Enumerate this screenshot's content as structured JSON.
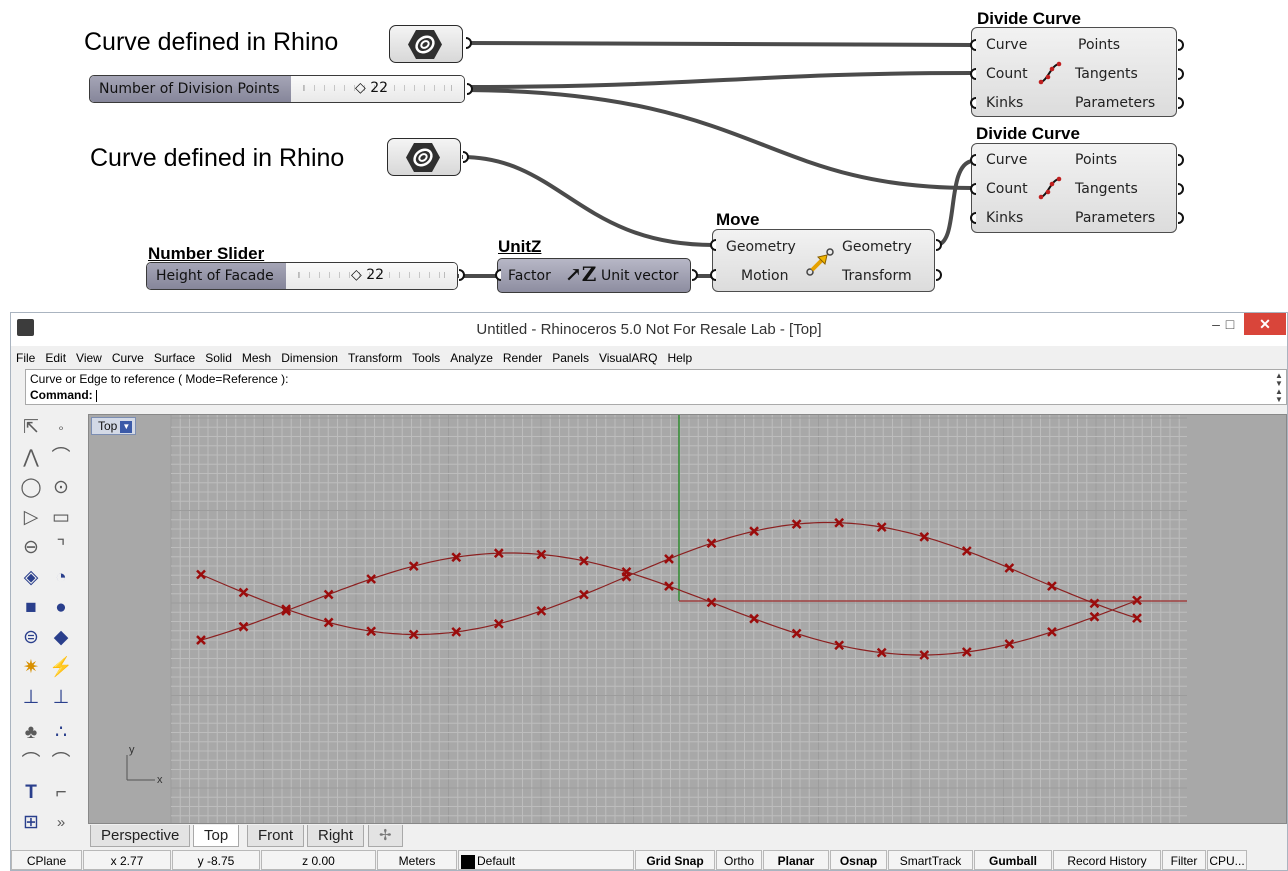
{
  "grasshopper": {
    "curve_label_1": "Curve defined in Rhino",
    "curve_label_2": "Curve defined in Rhino",
    "slider_1": {
      "name": "Number of Division Points",
      "value": "22"
    },
    "slider_2_title": "Number Slider",
    "slider_2": {
      "name": "Height of Facade",
      "value": "22"
    },
    "divide_1": {
      "title": "Divide Curve",
      "inputs": [
        "Curve",
        "Count",
        "Kinks"
      ],
      "outputs": [
        "Points",
        "Tangents",
        "Parameters"
      ]
    },
    "divide_2": {
      "title": "Divide Curve",
      "inputs": [
        "Curve",
        "Count",
        "Kinks"
      ],
      "outputs": [
        "Points",
        "Tangents",
        "Parameters"
      ]
    },
    "unitz": {
      "title": "UnitZ",
      "input": "Factor",
      "output": "Unit vector"
    },
    "move": {
      "title": "Move",
      "inputs": [
        "Geometry",
        "Motion"
      ],
      "outputs": [
        "Geometry",
        "Transform"
      ]
    },
    "colors": {
      "wire": "#4b4b4b",
      "component": "#e3e3e3",
      "dark_component": "#9b9bac"
    },
    "icons": {
      "curve_param": "curve-param-icon",
      "divide": "divide-curve-icon",
      "unitz": "unitz-icon",
      "move": "move-icon"
    }
  },
  "rhino": {
    "window_title": "Untitled - Rhinoceros 5.0 Not For Resale Lab - [Top]",
    "window_buttons": {
      "minimize": "–",
      "maximize": "□",
      "close": "✕"
    },
    "menu": [
      "File",
      "Edit",
      "View",
      "Curve",
      "Surface",
      "Solid",
      "Mesh",
      "Dimension",
      "Transform",
      "Tools",
      "Analyze",
      "Render",
      "Panels",
      "VisualARQ",
      "Help"
    ],
    "command_history": "Curve or Edge to reference ( Mode=Reference ):",
    "command_prompt": "Command:",
    "viewport_name": "Top",
    "axis_x": "x",
    "axis_y": "y",
    "view_tabs": [
      "Perspective",
      "Top",
      "Front",
      "Right"
    ],
    "add_tab": "✢",
    "active_tab": "Top",
    "status": {
      "cplane": "CPlane",
      "x": "x 2.77",
      "y": "y -8.75",
      "z": "z 0.00",
      "units": "Meters",
      "layer": "Default",
      "grid_snap": "Grid Snap",
      "ortho": "Ortho",
      "planar": "Planar",
      "osnap": "Osnap",
      "smarttrack": "SmartTrack",
      "gumball": "Gumball",
      "record_history": "Record History",
      "filter": "Filter",
      "cpu": "CPU..."
    },
    "toolbar_icons": [
      "select-arrow-icon",
      "point-icon",
      "polyline-icon",
      "curve-icon",
      "circle-icon",
      "ellipse-icon",
      "polygon-icon",
      "rectangle-icon",
      "arc-tangent-icon",
      "fillet-icon",
      "surface-icon",
      "sweep-icon",
      "box-icon",
      "sphere-icon",
      "cylinder-icon",
      "mesh-icon",
      "explode-icon",
      "boolean-icon",
      "gumball-icon",
      "align-icon",
      "shade-icon",
      "points-icon",
      "curve-edit-icon",
      "curve-edit-2-icon",
      "text-icon",
      "dimension-icon",
      "layout-icon",
      "more-icon"
    ],
    "colors": {
      "curve": "#8b2020",
      "point": "#9b0c0c",
      "viewport_bg": "#a8a8a8",
      "grid_minor": "#bdbdbd",
      "grid_major": "#9c9c9c",
      "y_axis": "#2f8a2f",
      "x_axis": "#a04040"
    }
  }
}
